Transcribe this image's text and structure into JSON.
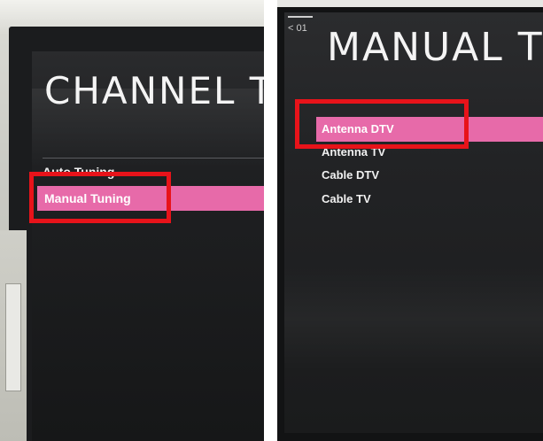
{
  "left_screen": {
    "title": "CHANNEL TUN",
    "items": [
      {
        "label": "Auto Tuning"
      },
      {
        "label": "Manual Tuning"
      }
    ],
    "highlighted": "Manual Tuning"
  },
  "right_screen": {
    "back_label": "< 01",
    "title": "MANUAL TUNI",
    "items": [
      {
        "label": "Antenna DTV"
      },
      {
        "label": "Antenna TV"
      },
      {
        "label": "Cable DTV"
      },
      {
        "label": "Cable TV"
      }
    ],
    "highlighted": "Antenna DTV"
  },
  "colors": {
    "selection": "#e76aa9",
    "annotation": "#e8131a",
    "screen_bg": "#1f2022"
  }
}
